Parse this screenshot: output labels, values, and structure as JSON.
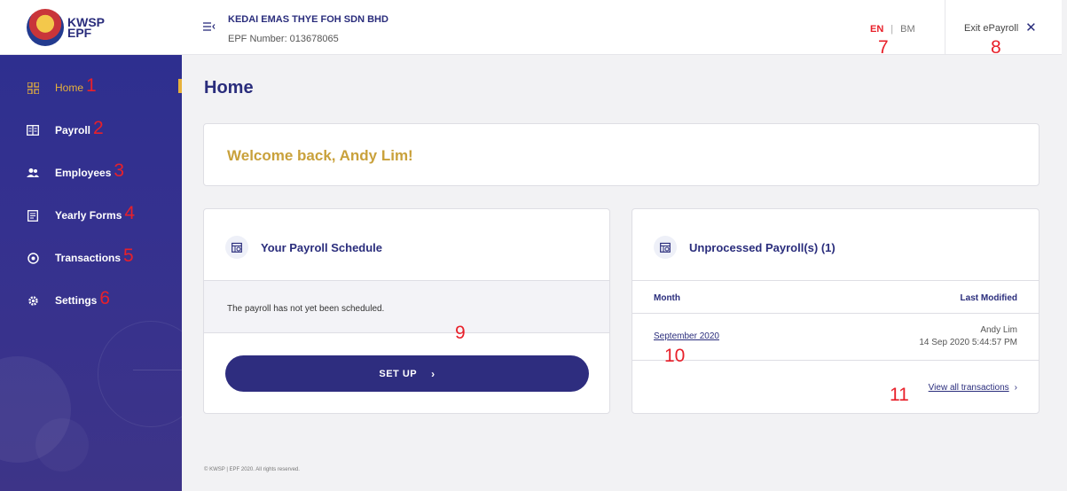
{
  "brand": {
    "logo_line1": "KWSP",
    "logo_line2": "EPF"
  },
  "header": {
    "company": "KEDAI EMAS THYE FOH SDN BHD",
    "epf_number": "EPF Number: 013678065",
    "lang_en": "EN",
    "lang_sep": "|",
    "lang_bm": "BM",
    "exit_label": "Exit ePayroll",
    "exit_icon": "✕"
  },
  "sidebar": {
    "items": [
      {
        "label": "Home",
        "icon": "dashboard-icon",
        "marker": "1"
      },
      {
        "label": "Payroll",
        "icon": "payroll-icon",
        "marker": "2"
      },
      {
        "label": "Employees",
        "icon": "users-icon",
        "marker": "3"
      },
      {
        "label": "Yearly Forms",
        "icon": "form-icon",
        "marker": "4"
      },
      {
        "label": "Transactions",
        "icon": "transaction-icon",
        "marker": "5"
      },
      {
        "label": "Settings",
        "icon": "gear-icon",
        "marker": "6"
      }
    ]
  },
  "markers": {
    "lang": "7",
    "exit": "8",
    "schedule": "9",
    "month": "10",
    "view_all": "11"
  },
  "main": {
    "page_title": "Home",
    "welcome": "Welcome back, Andy Lim!",
    "schedule": {
      "title": "Your Payroll Schedule",
      "message": "The payroll has not yet been scheduled.",
      "button": "SET UP",
      "button_chev": "›"
    },
    "unprocessed": {
      "title": "Unprocessed Payroll(s) (1)",
      "col_month": "Month",
      "col_modified": "Last Modified",
      "rows": [
        {
          "month": "September 2020",
          "user": "Andy Lim",
          "date": "14 Sep 2020 5:44:57 PM"
        }
      ],
      "view_all": "View all transactions",
      "view_all_chev": "›"
    },
    "footer": "© KWSP | EPF 2020. All rights reserved."
  },
  "colors": {
    "primary": "#2e2d7f",
    "accent": "#e7b13b",
    "welcome": "#c9a13b",
    "marker": "#e8202a"
  }
}
